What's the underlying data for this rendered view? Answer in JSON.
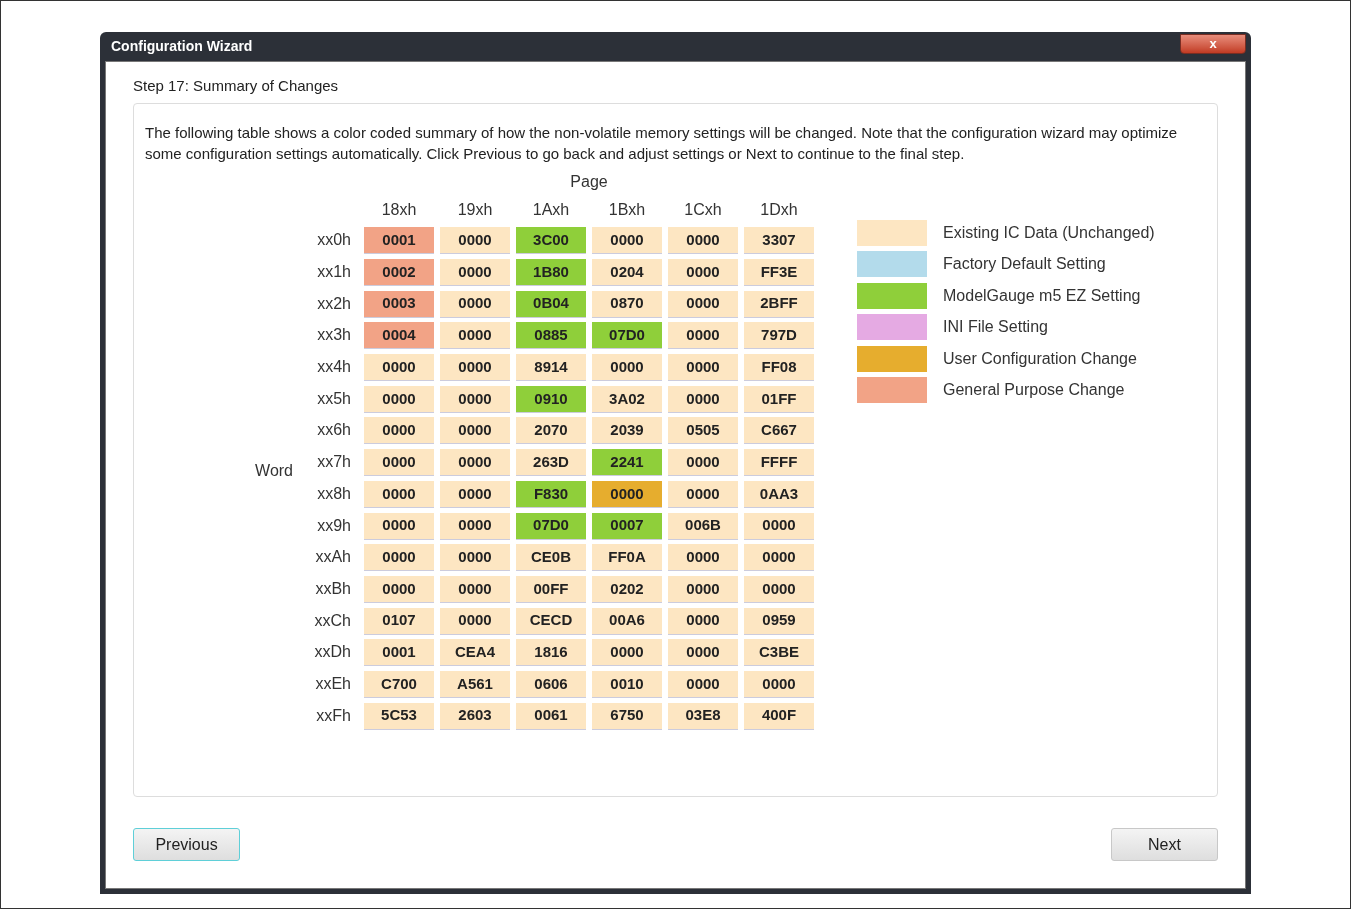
{
  "window": {
    "title": "Configuration Wizard",
    "close": "x"
  },
  "step_title": "Step 17: Summary of Changes",
  "description": "The following table shows a color coded summary of how the non-volatile memory settings will be changed. Note that the configuration wizard may optimize some configuration settings automatically. Click Previous to go back and adjust settings or Next to continue to the final step.",
  "table": {
    "column_axis": "Page",
    "row_axis": "Word",
    "columns": [
      "18xh",
      "19xh",
      "1Axh",
      "1Bxh",
      "1Cxh",
      "1Dxh"
    ],
    "rows": [
      {
        "label": "xx0h",
        "cells": [
          {
            "value": "0001",
            "kind": "general"
          },
          {
            "value": "0000",
            "kind": "existing"
          },
          {
            "value": "3C00",
            "kind": "modelgauge"
          },
          {
            "value": "0000",
            "kind": "existing"
          },
          {
            "value": "0000",
            "kind": "existing"
          },
          {
            "value": "3307",
            "kind": "existing"
          }
        ]
      },
      {
        "label": "xx1h",
        "cells": [
          {
            "value": "0002",
            "kind": "general"
          },
          {
            "value": "0000",
            "kind": "existing"
          },
          {
            "value": "1B80",
            "kind": "modelgauge"
          },
          {
            "value": "0204",
            "kind": "existing"
          },
          {
            "value": "0000",
            "kind": "existing"
          },
          {
            "value": "FF3E",
            "kind": "existing"
          }
        ]
      },
      {
        "label": "xx2h",
        "cells": [
          {
            "value": "0003",
            "kind": "general"
          },
          {
            "value": "0000",
            "kind": "existing"
          },
          {
            "value": "0B04",
            "kind": "modelgauge"
          },
          {
            "value": "0870",
            "kind": "existing"
          },
          {
            "value": "0000",
            "kind": "existing"
          },
          {
            "value": "2BFF",
            "kind": "existing"
          }
        ]
      },
      {
        "label": "xx3h",
        "cells": [
          {
            "value": "0004",
            "kind": "general"
          },
          {
            "value": "0000",
            "kind": "existing"
          },
          {
            "value": "0885",
            "kind": "modelgauge"
          },
          {
            "value": "07D0",
            "kind": "modelgauge"
          },
          {
            "value": "0000",
            "kind": "existing"
          },
          {
            "value": "797D",
            "kind": "existing"
          }
        ]
      },
      {
        "label": "xx4h",
        "cells": [
          {
            "value": "0000",
            "kind": "existing"
          },
          {
            "value": "0000",
            "kind": "existing"
          },
          {
            "value": "8914",
            "kind": "existing"
          },
          {
            "value": "0000",
            "kind": "existing"
          },
          {
            "value": "0000",
            "kind": "existing"
          },
          {
            "value": "FF08",
            "kind": "existing"
          }
        ]
      },
      {
        "label": "xx5h",
        "cells": [
          {
            "value": "0000",
            "kind": "existing"
          },
          {
            "value": "0000",
            "kind": "existing"
          },
          {
            "value": "0910",
            "kind": "modelgauge"
          },
          {
            "value": "3A02",
            "kind": "existing"
          },
          {
            "value": "0000",
            "kind": "existing"
          },
          {
            "value": "01FF",
            "kind": "existing"
          }
        ]
      },
      {
        "label": "xx6h",
        "cells": [
          {
            "value": "0000",
            "kind": "existing"
          },
          {
            "value": "0000",
            "kind": "existing"
          },
          {
            "value": "2070",
            "kind": "existing"
          },
          {
            "value": "2039",
            "kind": "existing"
          },
          {
            "value": "0505",
            "kind": "existing"
          },
          {
            "value": "C667",
            "kind": "existing"
          }
        ]
      },
      {
        "label": "xx7h",
        "cells": [
          {
            "value": "0000",
            "kind": "existing"
          },
          {
            "value": "0000",
            "kind": "existing"
          },
          {
            "value": "263D",
            "kind": "existing"
          },
          {
            "value": "2241",
            "kind": "modelgauge"
          },
          {
            "value": "0000",
            "kind": "existing"
          },
          {
            "value": "FFFF",
            "kind": "existing"
          }
        ]
      },
      {
        "label": "xx8h",
        "cells": [
          {
            "value": "0000",
            "kind": "existing"
          },
          {
            "value": "0000",
            "kind": "existing"
          },
          {
            "value": "F830",
            "kind": "modelgauge"
          },
          {
            "value": "0000",
            "kind": "user"
          },
          {
            "value": "0000",
            "kind": "existing"
          },
          {
            "value": "0AA3",
            "kind": "existing"
          }
        ]
      },
      {
        "label": "xx9h",
        "cells": [
          {
            "value": "0000",
            "kind": "existing"
          },
          {
            "value": "0000",
            "kind": "existing"
          },
          {
            "value": "07D0",
            "kind": "modelgauge"
          },
          {
            "value": "0007",
            "kind": "modelgauge"
          },
          {
            "value": "006B",
            "kind": "existing"
          },
          {
            "value": "0000",
            "kind": "existing"
          }
        ]
      },
      {
        "label": "xxAh",
        "cells": [
          {
            "value": "0000",
            "kind": "existing"
          },
          {
            "value": "0000",
            "kind": "existing"
          },
          {
            "value": "CE0B",
            "kind": "existing"
          },
          {
            "value": "FF0A",
            "kind": "existing"
          },
          {
            "value": "0000",
            "kind": "existing"
          },
          {
            "value": "0000",
            "kind": "existing"
          }
        ]
      },
      {
        "label": "xxBh",
        "cells": [
          {
            "value": "0000",
            "kind": "existing"
          },
          {
            "value": "0000",
            "kind": "existing"
          },
          {
            "value": "00FF",
            "kind": "existing"
          },
          {
            "value": "0202",
            "kind": "existing"
          },
          {
            "value": "0000",
            "kind": "existing"
          },
          {
            "value": "0000",
            "kind": "existing"
          }
        ]
      },
      {
        "label": "xxCh",
        "cells": [
          {
            "value": "0107",
            "kind": "existing"
          },
          {
            "value": "0000",
            "kind": "existing"
          },
          {
            "value": "CECD",
            "kind": "existing"
          },
          {
            "value": "00A6",
            "kind": "existing"
          },
          {
            "value": "0000",
            "kind": "existing"
          },
          {
            "value": "0959",
            "kind": "existing"
          }
        ]
      },
      {
        "label": "xxDh",
        "cells": [
          {
            "value": "0001",
            "kind": "existing"
          },
          {
            "value": "CEA4",
            "kind": "existing"
          },
          {
            "value": "1816",
            "kind": "existing"
          },
          {
            "value": "0000",
            "kind": "existing"
          },
          {
            "value": "0000",
            "kind": "existing"
          },
          {
            "value": "C3BE",
            "kind": "existing"
          }
        ]
      },
      {
        "label": "xxEh",
        "cells": [
          {
            "value": "C700",
            "kind": "existing"
          },
          {
            "value": "A561",
            "kind": "existing"
          },
          {
            "value": "0606",
            "kind": "existing"
          },
          {
            "value": "0010",
            "kind": "existing"
          },
          {
            "value": "0000",
            "kind": "existing"
          },
          {
            "value": "0000",
            "kind": "existing"
          }
        ]
      },
      {
        "label": "xxFh",
        "cells": [
          {
            "value": "5C53",
            "kind": "existing"
          },
          {
            "value": "2603",
            "kind": "existing"
          },
          {
            "value": "0061",
            "kind": "existing"
          },
          {
            "value": "6750",
            "kind": "existing"
          },
          {
            "value": "03E8",
            "kind": "existing"
          },
          {
            "value": "400F",
            "kind": "existing"
          }
        ]
      }
    ]
  },
  "legend": [
    {
      "kind": "existing",
      "label": "Existing IC Data (Unchanged)",
      "color": "#fde6c2"
    },
    {
      "kind": "factory",
      "label": "Factory Default Setting",
      "color": "#b3dbeb"
    },
    {
      "kind": "modelgauge",
      "label": "ModelGauge m5 EZ Setting",
      "color": "#8fcf3a"
    },
    {
      "kind": "ini",
      "label": "INI File Setting",
      "color": "#e5aae3"
    },
    {
      "kind": "user",
      "label": "User Configuration Change",
      "color": "#e6ad2e"
    },
    {
      "kind": "general",
      "label": "General Purpose Change",
      "color": "#f2a386"
    }
  ],
  "buttons": {
    "previous": "Previous",
    "next": "Next"
  }
}
